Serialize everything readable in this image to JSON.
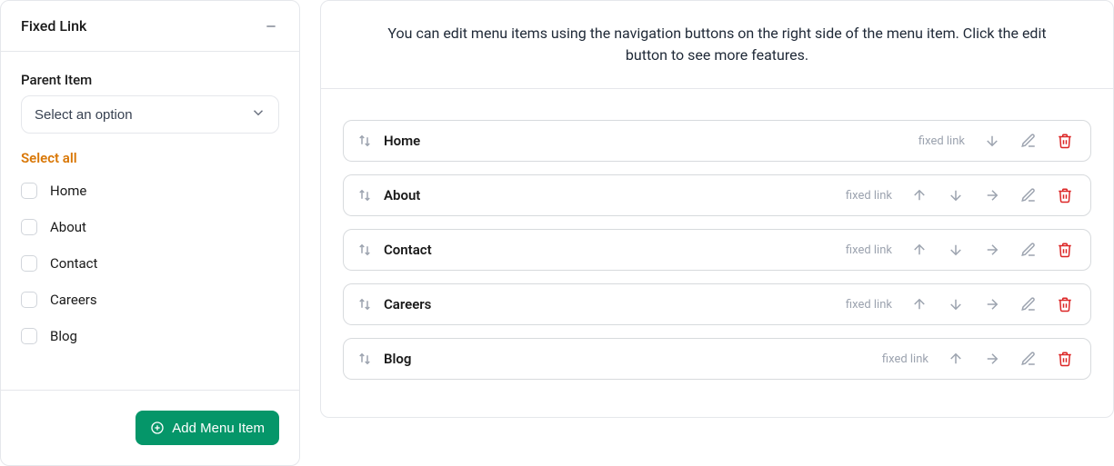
{
  "left": {
    "section_title": "Fixed Link",
    "parent_label": "Parent Item",
    "parent_placeholder": "Select an option",
    "select_all_label": "Select all",
    "options": [
      {
        "label": "Home"
      },
      {
        "label": "About"
      },
      {
        "label": "Contact"
      },
      {
        "label": "Careers"
      },
      {
        "label": "Blog"
      }
    ],
    "add_button_label": "Add Menu Item"
  },
  "right": {
    "header_text": "You can edit menu items using the navigation buttons on the right side of the menu item. Click the edit button to see more features.",
    "type_label": "fixed link",
    "items": [
      {
        "title": "Home",
        "up": false,
        "down": true,
        "right": false
      },
      {
        "title": "About",
        "up": true,
        "down": true,
        "right": true
      },
      {
        "title": "Contact",
        "up": true,
        "down": true,
        "right": true
      },
      {
        "title": "Careers",
        "up": true,
        "down": true,
        "right": true
      },
      {
        "title": "Blog",
        "up": true,
        "down": false,
        "right": true
      }
    ]
  }
}
